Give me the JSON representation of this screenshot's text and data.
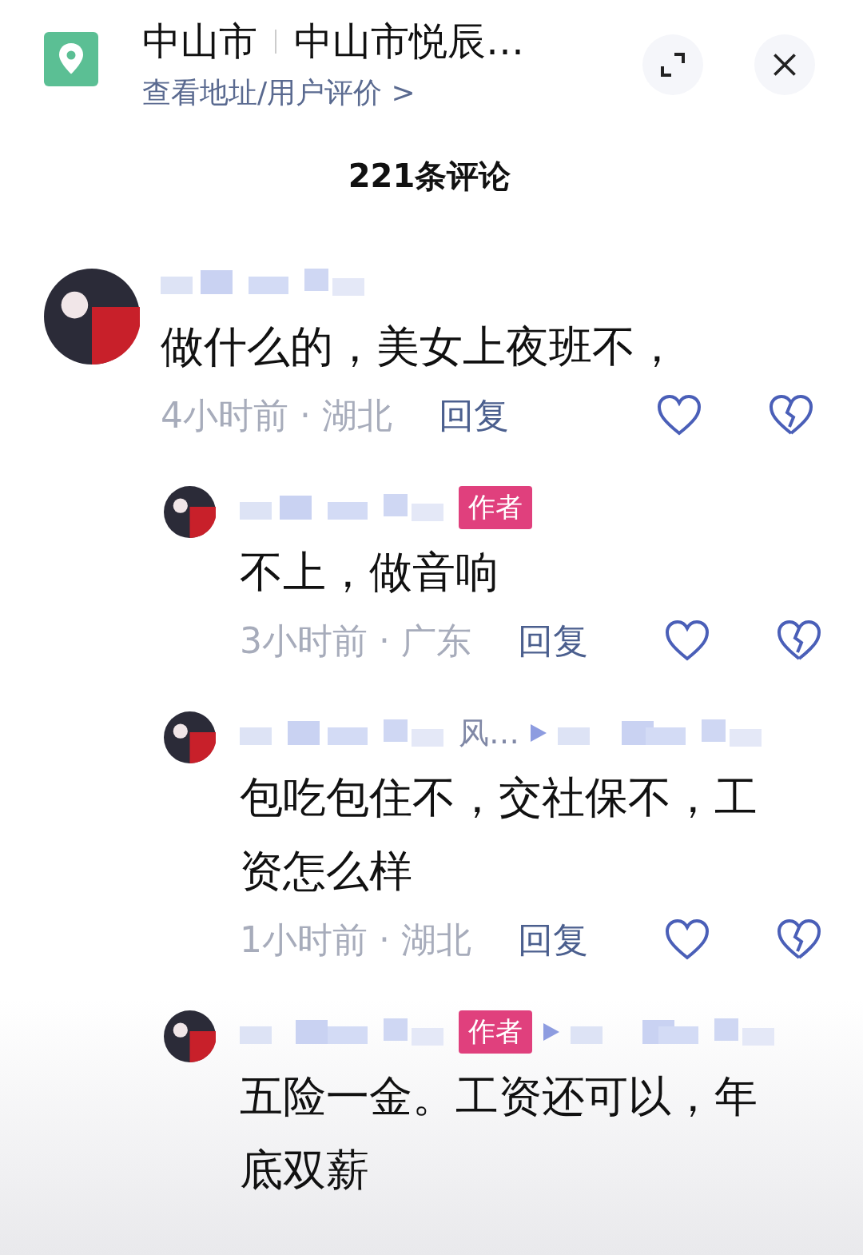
{
  "header": {
    "city": "中山市",
    "place": "中山市悦辰…",
    "subtitle": "查看地址/用户评价 >"
  },
  "comment_count": "221条评论",
  "comments": [
    {
      "text": "做什么的，美女上夜班不，",
      "time": "4小时前",
      "location": "· 湖北",
      "reply": "回复",
      "children": [
        {
          "text": "不上，做音响",
          "time": "3小时前",
          "location": "· 广东",
          "reply": "回复",
          "author": true,
          "badge": "作者",
          "reply_arrow": false
        },
        {
          "text": "包吃包住不，交社保不，工资怎么样",
          "time": "1小时前",
          "location": "· 湖北",
          "reply": "回复",
          "author": false,
          "name_fragment": "风…",
          "reply_arrow": true
        },
        {
          "text": "五险一金。工资还可以，年底双薪",
          "author": true,
          "badge": "作者",
          "reply_arrow": true
        }
      ]
    }
  ]
}
